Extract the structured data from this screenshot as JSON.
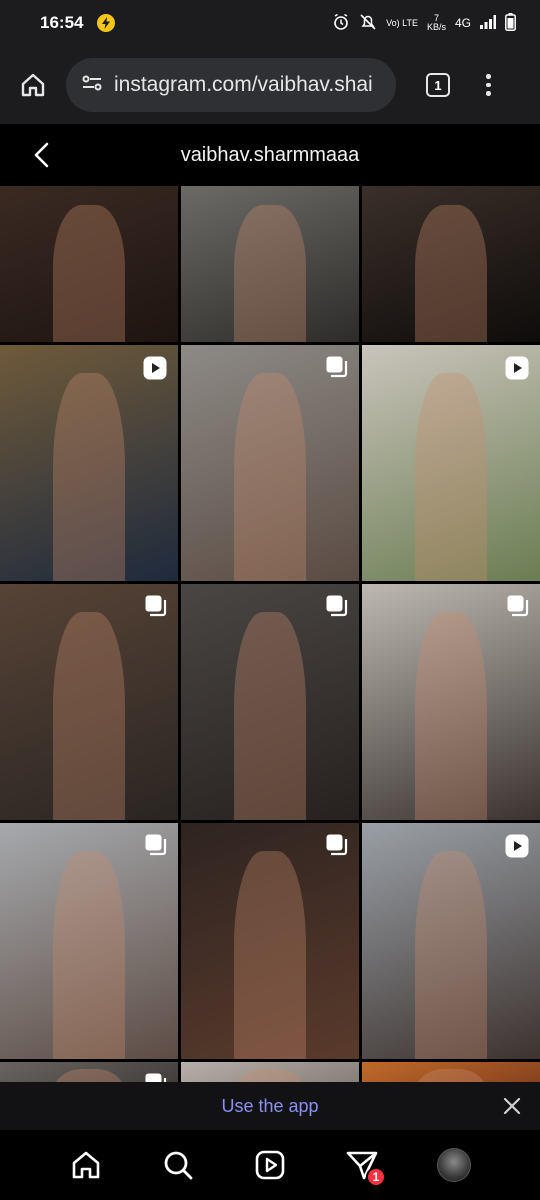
{
  "status_bar": {
    "time": "16:54",
    "volte": "Vo) LTE",
    "speed_value": "7",
    "speed_unit": "KB/s",
    "network": "4G"
  },
  "browser": {
    "url": "instagram.com/vaibhav.shai",
    "tab_count": "1"
  },
  "profile": {
    "username": "vaibhav.sharmmaaa"
  },
  "grid": {
    "tiles": [
      {
        "type": "none",
        "colors": [
          "#3a2a22",
          "#1e1411"
        ]
      },
      {
        "type": "none",
        "colors": [
          "#6b6a66",
          "#2e2c2a"
        ]
      },
      {
        "type": "none",
        "colors": [
          "#3b2f29",
          "#0e0c0b"
        ]
      },
      {
        "type": "reel",
        "colors": [
          "#6f5a3a",
          "#1e2a3d"
        ]
      },
      {
        "type": "carousel",
        "colors": [
          "#8d8a86",
          "#5a4b42"
        ]
      },
      {
        "type": "reel",
        "colors": [
          "#c9c4bb",
          "#6b7d52"
        ]
      },
      {
        "type": "carousel",
        "colors": [
          "#574336",
          "#2a2522"
        ]
      },
      {
        "type": "carousel",
        "colors": [
          "#4a4644",
          "#26211f"
        ]
      },
      {
        "type": "carousel",
        "colors": [
          "#bdb8b2",
          "#3a3330"
        ]
      },
      {
        "type": "carousel",
        "colors": [
          "#a6a9ad",
          "#5d4c44"
        ]
      },
      {
        "type": "carousel",
        "colors": [
          "#2e2420",
          "#5a3a2c"
        ]
      },
      {
        "type": "reel",
        "colors": [
          "#9aa0a6",
          "#3d3330"
        ]
      },
      {
        "type": "carousel",
        "colors": [
          "#6a6460",
          "#302c2a"
        ]
      },
      {
        "type": "none",
        "colors": [
          "#b7b0a8",
          "#6f6863"
        ]
      },
      {
        "type": "none",
        "colors": [
          "#c06a2a",
          "#6b2f18"
        ]
      }
    ]
  },
  "banner": {
    "use_app_label": "Use the app"
  },
  "bottom_nav": {
    "items": [
      "home-icon",
      "search-icon",
      "reels-icon",
      "direct-messages-icon",
      "profile-avatar"
    ],
    "notification_count": "1"
  },
  "colors": {
    "chrome_bg": "#1c1c1f",
    "url_bg": "#2f3033",
    "link_accent": "#8a8ff0",
    "badge_red": "#ff3040"
  }
}
